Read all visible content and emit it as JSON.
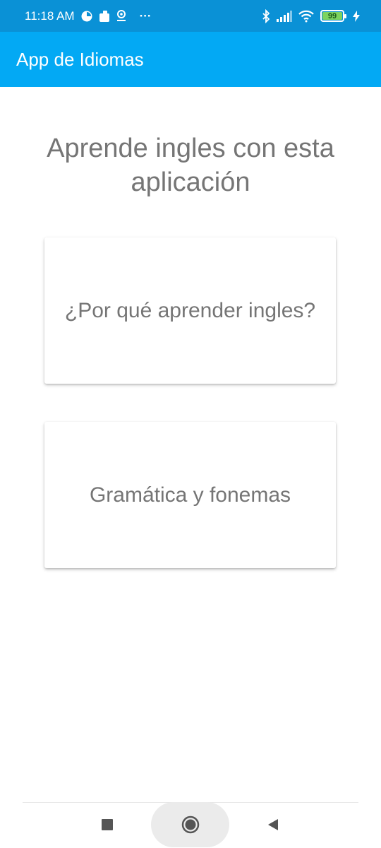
{
  "status_bar": {
    "time": "11:18 AM",
    "dots": "···",
    "battery_level": "99",
    "battery_fraction": 0.99,
    "icons_left": [
      "data-saver-icon",
      "notification-icon",
      "settings-app-icon"
    ],
    "icons_right": [
      "bluetooth-icon",
      "cellular-signal-icon",
      "wifi-icon",
      "battery-icon",
      "charging-icon"
    ]
  },
  "app_bar": {
    "title": "App de Idiomas",
    "color": "#03a9f4"
  },
  "main": {
    "headline": "Aprende ingles con esta aplicación",
    "cards": [
      {
        "label": "¿Por qué aprender ingles?"
      },
      {
        "label": "Gramática y fonemas"
      }
    ]
  },
  "nav_bar": {
    "buttons": [
      "recent-apps",
      "home",
      "back"
    ]
  }
}
